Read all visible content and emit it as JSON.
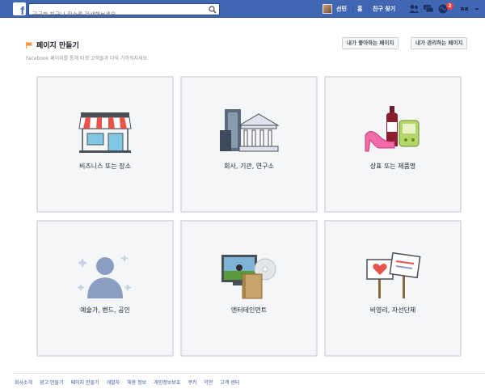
{
  "topbar": {
    "logo": "f",
    "search_placeholder": "궁금한 친구나 장소를 검색해보세요.",
    "user_name": "선민",
    "home_label": "홈",
    "find_friends_label": "친구 찾기",
    "notification_count": "2",
    "colors": {
      "bar": "#4267b2",
      "badge": "#fa3e3e"
    }
  },
  "header": {
    "title": "페이지 만들기",
    "subtitle": "Facebook 페이지를 통해 타겟 고객들과 더욱 가까워지세요.",
    "liked_pages_button": "내가 좋아하는 페이지",
    "managed_pages_button": "내가 관리하는 페이지"
  },
  "categories": [
    {
      "label": "비즈니스 또는 장소",
      "icon": "storefront-icon"
    },
    {
      "label": "회사, 기관, 연구소",
      "icon": "buildings-icon"
    },
    {
      "label": "상표 또는 제품명",
      "icon": "products-icon"
    },
    {
      "label": "예술가, 밴드, 공인",
      "icon": "artist-silhouette-icon"
    },
    {
      "label": "엔터테인먼트",
      "icon": "media-icon"
    },
    {
      "label": "비영리, 자선단체",
      "icon": "signs-icon"
    }
  ],
  "footer": {
    "links": [
      "회사소개",
      "광고 만들기",
      "페이지 만들기",
      "개발자",
      "채용 정보",
      "개인정보보호",
      "쿠키",
      "약관",
      "고객 센터"
    ]
  }
}
